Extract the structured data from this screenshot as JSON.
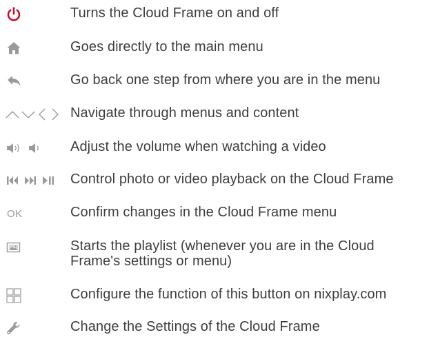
{
  "colors": {
    "text": "#3d3d3d",
    "icon": "#9a9a9a",
    "power": "#c8102e"
  },
  "items": [
    {
      "icon": "power-icon",
      "text": "Turns the Cloud Frame on and off"
    },
    {
      "icon": "home-icon",
      "text": "Goes directly to the main menu"
    },
    {
      "icon": "back-arrow-icon",
      "text": "Go back one step from where you are in the menu"
    },
    {
      "icon": "navigation-arrows-icon",
      "text": "Navigate through menus and content"
    },
    {
      "icon": "volume-icon",
      "text": "Adjust the volume when watching a video"
    },
    {
      "icon": "playback-controls-icon",
      "text": "Control photo or video playback on the Cloud Frame"
    },
    {
      "icon": "ok-icon",
      "label": "OK",
      "text": "Confirm changes in the Cloud Frame menu"
    },
    {
      "icon": "playlist-icon",
      "text": "Starts the playlist (whenever you are in the Cloud Frame's settings or menu)"
    },
    {
      "icon": "grid-icon",
      "text": "Configure the function of this button on nixplay.com"
    },
    {
      "icon": "wrench-icon",
      "text": "Change the Settings of the Cloud Frame"
    }
  ]
}
